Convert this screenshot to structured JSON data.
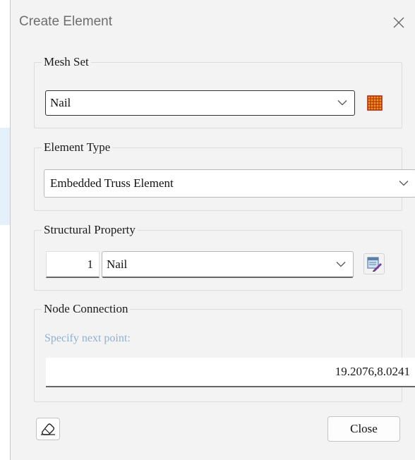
{
  "dialog": {
    "title": "Create Element",
    "close_glyph": "×"
  },
  "mesh_set": {
    "legend": "Mesh Set",
    "selected": "Nail",
    "grid_icon": "mesh-grid-icon"
  },
  "element_type": {
    "legend": "Element Type",
    "selected": "Embedded Truss Element"
  },
  "structural_property": {
    "legend": "Structural Property",
    "id": "1",
    "selected": "Nail",
    "edit_icon": "property-edit-icon"
  },
  "node_connection": {
    "legend": "Node Connection",
    "prompt": "Specify next point:",
    "coordinates": "19.2076,8.0241"
  },
  "footer": {
    "eraser_icon": "eraser-icon",
    "close_label": "Close"
  },
  "colors": {
    "dialog_bg": "#f3f3f3",
    "prompt_text": "#8fb0d4",
    "grid_icon_fill": "#e89b1a",
    "grid_icon_lines": "#b3200f"
  }
}
